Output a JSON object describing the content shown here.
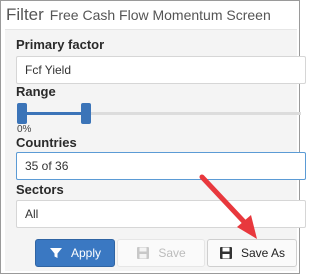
{
  "header": {
    "title": "Filter",
    "subtitle": "Free Cash Flow Momentum Screen"
  },
  "primary_factor": {
    "label": "Primary factor",
    "value": "Fcf Yield"
  },
  "range": {
    "label": "Range",
    "min_label": "0%",
    "selected_fraction": 0.23
  },
  "countries": {
    "label": "Countries",
    "value": "35 of 36"
  },
  "sectors": {
    "label": "Sectors",
    "value": "All"
  },
  "buttons": {
    "apply": "Apply",
    "save": "Save",
    "save_as": "Save As"
  },
  "colors": {
    "accent": "#3a78c2",
    "annotation_arrow": "#e8383d"
  },
  "icons": {
    "apply": "filter-icon",
    "save": "floppy-disk-icon",
    "save_as": "floppy-disk-icon"
  }
}
